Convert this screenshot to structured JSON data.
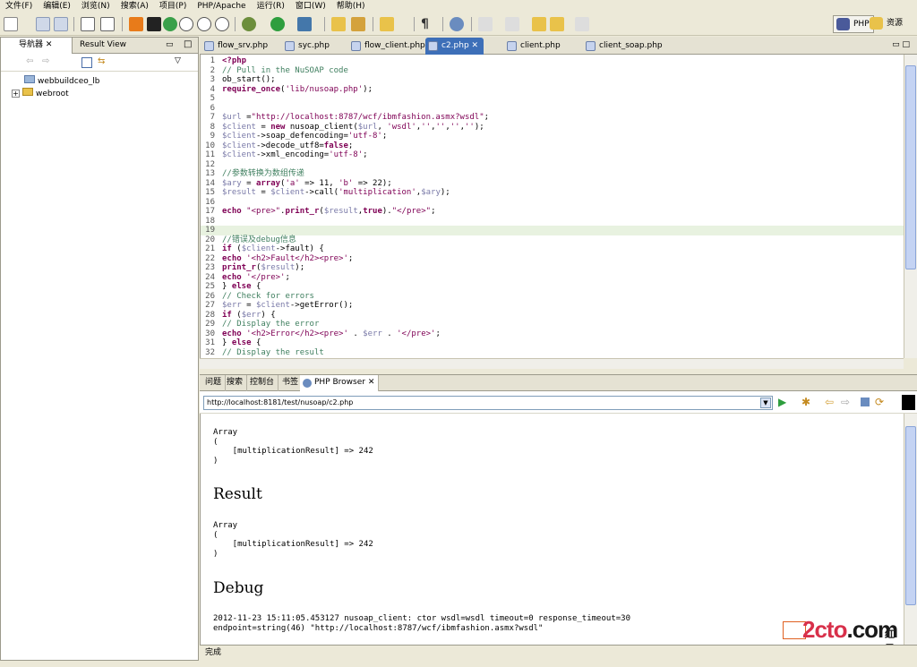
{
  "menu": [
    "文件(F)",
    "编辑(E)",
    "浏览(N)",
    "搜索(A)",
    "项目(P)",
    "PHP/Apache",
    "运行(R)",
    "窗口(W)",
    "帮助(H)"
  ],
  "perspectives": {
    "php": "PHP",
    "resources": "资源"
  },
  "navigator": {
    "tab_active": "导航器",
    "tab_other": "Result View",
    "tree": [
      {
        "label": "webbuildceo_lb",
        "expanded": false
      },
      {
        "label": "webroot",
        "expanded": false
      }
    ]
  },
  "editor_tabs": [
    {
      "label": "flow_srv.php",
      "active": false
    },
    {
      "label": "syc.php",
      "active": false
    },
    {
      "label": "flow_client.php",
      "active": false
    },
    {
      "label": "c2.php",
      "active": true
    },
    {
      "label": "client.php",
      "active": false
    },
    {
      "label": "client_soap.php",
      "active": false
    }
  ],
  "code_lines": [
    "<?php",
    "// Pull in the NuSOAP code",
    "ob_start();",
    "require_once('lib/nusoap.php');",
    "",
    "",
    "$url =\"http://localhost:8787/wcf/ibmfashion.asmx?wsdl\";",
    "$client = new nusoap_client($url, 'wsdl','','','','');",
    "$client->soap_defencoding='utf-8';",
    "$client->decode_utf8=false;",
    "$client->xml_encoding='utf-8';",
    "",
    "//参数转换为数组传递",
    "$ary = array('a' => 11, 'b' => 22);",
    "$result = $client->call('multiplication',$ary);",
    "",
    "echo \"<pre>\".print_r($result,true).\"</pre>\";",
    "",
    "",
    "//错误及debug信息",
    "if ($client->fault) {",
    "echo '<h2>Fault</h2><pre>';",
    "print_r($result);",
    "echo '</pre>';",
    "} else {",
    "// Check for errors",
    "$err = $client->getError();",
    "if ($err) {",
    "// Display the error",
    "echo '<h2>Error</h2><pre>' . $err . '</pre>';",
    "} else {",
    "// Display the result"
  ],
  "bottom_tabs": [
    "问题",
    "搜索",
    "控制台",
    "书签",
    "PHP Browser"
  ],
  "browser": {
    "url": "http://localhost:8181/test/nusoap/c2.php",
    "block1": "Array\n(\n    [multiplicationResult] => 242\n)",
    "heading_result": "Result",
    "block2": "Array\n(\n    [multiplicationResult] => 242\n)",
    "heading_debug": "Debug",
    "debug_line1": "2012-11-23 15:11:05.453127 nusoap_client: ctor wsdl=wsdl timeout=0 response_timeout=30",
    "debug_line2": "endpoint=string(46) \"http://localhost:8787/wcf/ibmfashion.asmx?wsdl\""
  },
  "status": "完成",
  "watermark": {
    "text": "2cto",
    "suffix": ".com",
    "brand": "红黑联盟"
  }
}
